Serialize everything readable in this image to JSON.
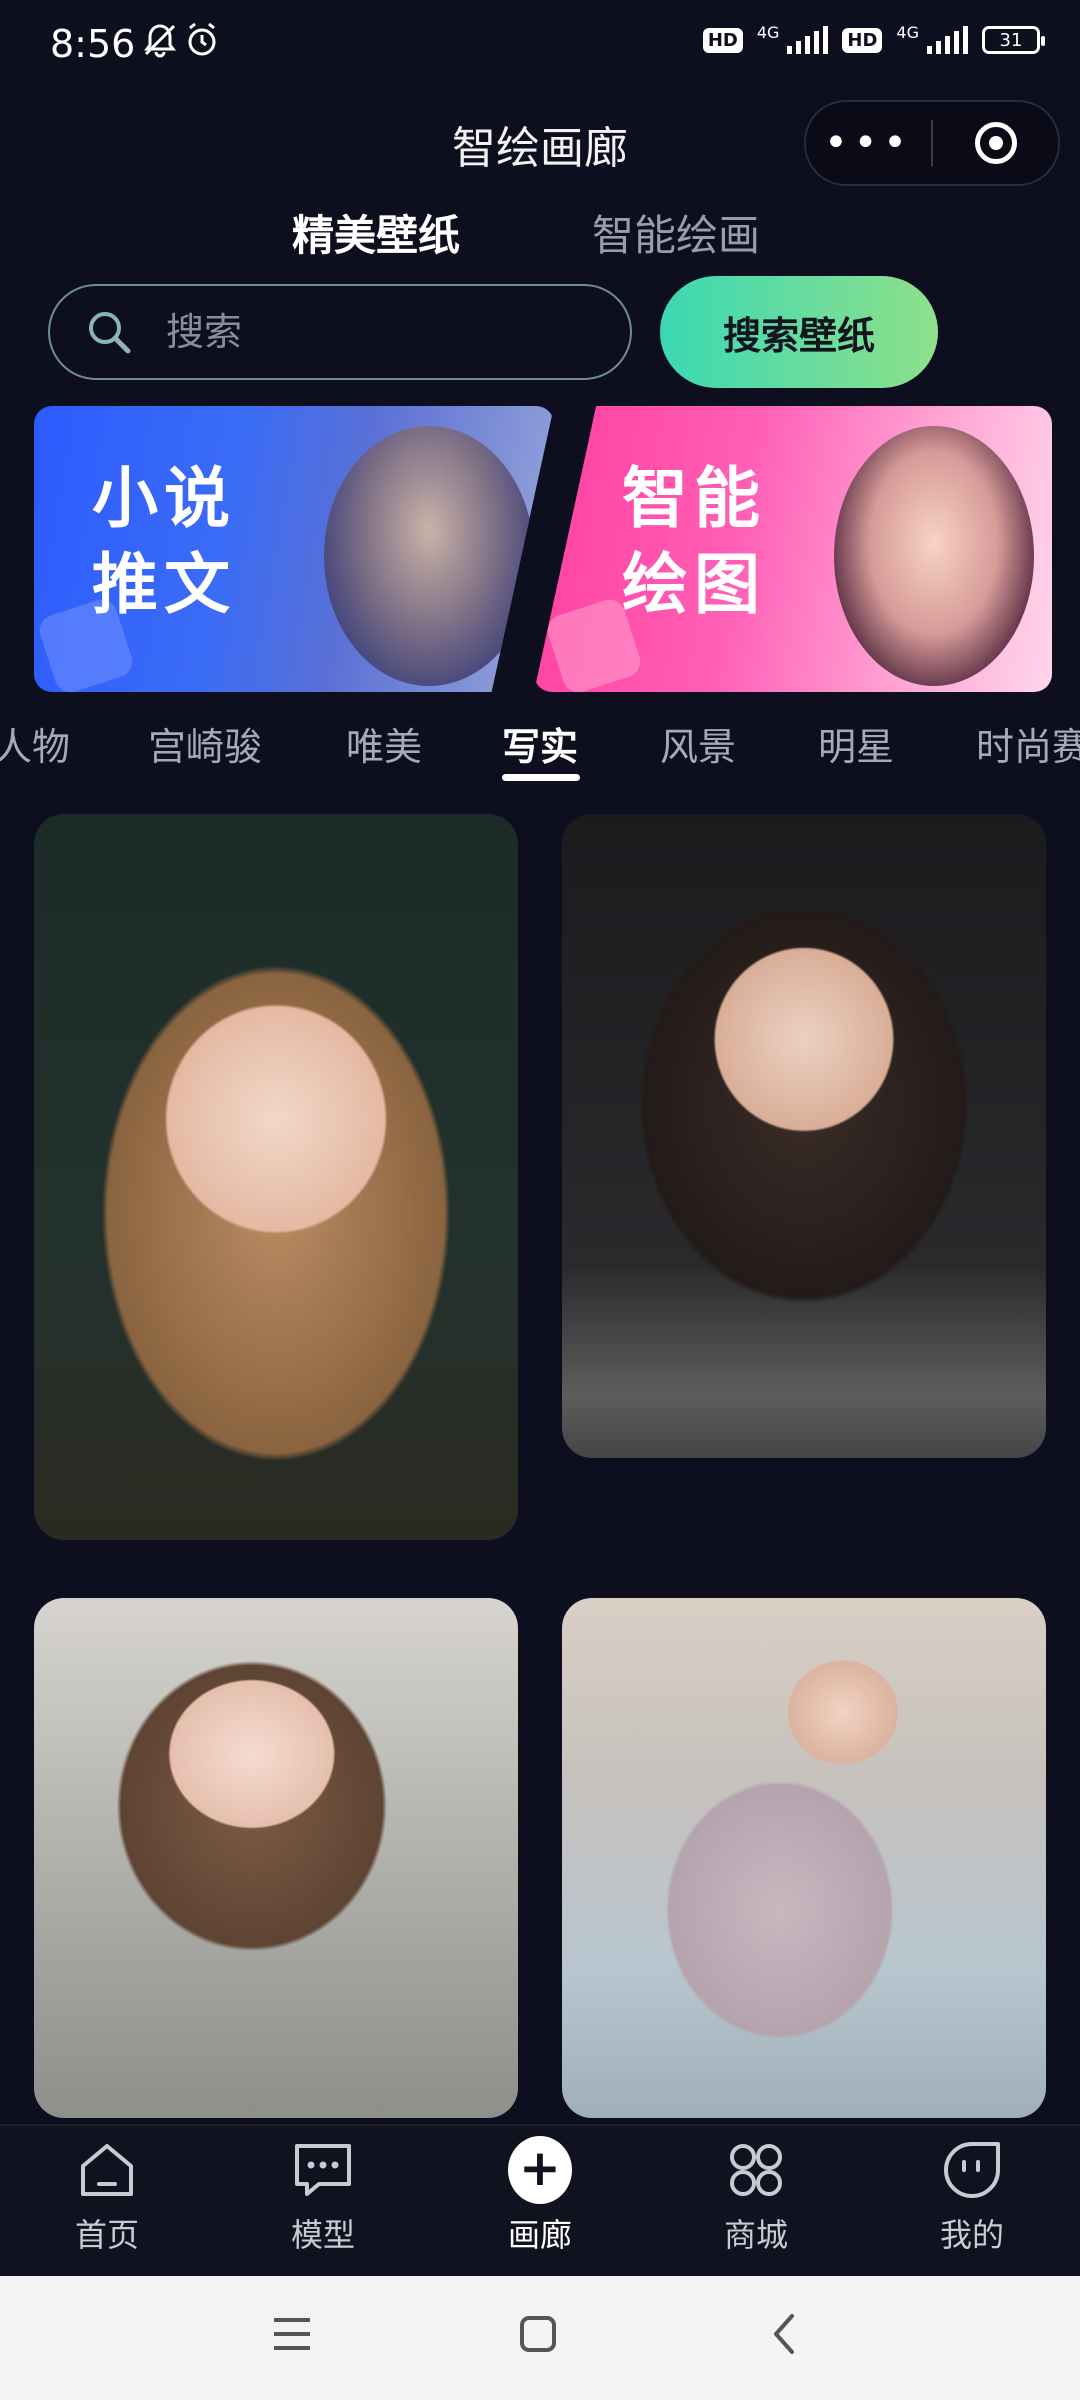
{
  "status_bar": {
    "time": "8:56",
    "hd_label": "HD",
    "network_label": "4G",
    "battery": "31"
  },
  "header": {
    "title": "智绘画廊",
    "more_icon": "more-dots-icon",
    "target_icon": "target-icon"
  },
  "top_tabs": [
    {
      "label": "精美壁纸",
      "active": true
    },
    {
      "label": "智能绘画",
      "active": false
    }
  ],
  "search": {
    "placeholder": "搜索",
    "button_label": "搜索壁纸"
  },
  "banners": [
    {
      "line1": "小说",
      "line2": "推文",
      "color": "#2e5bff"
    },
    {
      "line1": "智能",
      "line2": "绘图",
      "color": "#ff3f9f"
    }
  ],
  "categories": [
    "人物",
    "宫崎骏",
    "唯美",
    "写实",
    "风景",
    "明星",
    "时尚赛"
  ],
  "active_category": "写实",
  "bottom_nav": [
    {
      "label": "首页",
      "icon": "home-icon"
    },
    {
      "label": "模型",
      "icon": "chat-bubble-icon"
    },
    {
      "label": "画廊",
      "icon": "plus-circle-icon",
      "active": true
    },
    {
      "label": "商城",
      "icon": "grid-icon"
    },
    {
      "label": "我的",
      "icon": "smiley-icon"
    }
  ],
  "system_nav": [
    "menu-icon",
    "home-square-icon",
    "back-icon"
  ],
  "colors": {
    "background": "#0d0f1e",
    "accent_gradient_start": "#3bd8b4",
    "accent_gradient_end": "#8fe08a"
  }
}
